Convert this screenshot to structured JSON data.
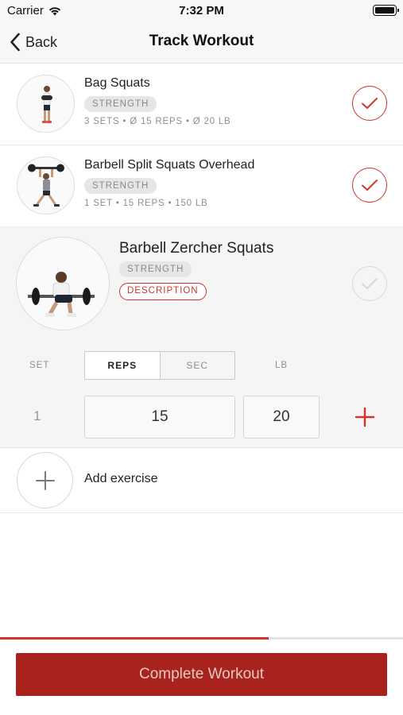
{
  "status_bar": {
    "carrier": "Carrier",
    "time": "7:32 PM"
  },
  "nav": {
    "back_label": "Back",
    "title": "Track Workout"
  },
  "exercises": [
    {
      "name": "Bag Squats",
      "tag": "STRENGTH",
      "meta": "3 SETS • Ø 15 REPS • Ø 20 LB",
      "completed": true
    },
    {
      "name": "Barbell Split Squats Overhead",
      "tag": "STRENGTH",
      "meta": "1 SET • 15 REPS • 150 LB",
      "completed": true
    }
  ],
  "active_exercise": {
    "name": "Barbell Zercher Squats",
    "tag": "STRENGTH",
    "description_label": "DESCRIPTION",
    "completed": false,
    "columns": {
      "set": "SET",
      "reps": "REPS",
      "sec": "SEC",
      "lb": "LB"
    },
    "selected_mode": "REPS",
    "sets": [
      {
        "set": "1",
        "reps": "15",
        "lb": "20"
      }
    ]
  },
  "add_exercise": {
    "label": "Add exercise"
  },
  "progress": {
    "fraction": 0.667
  },
  "complete_button": {
    "label": "Complete Workout"
  },
  "colors": {
    "accent": "#d0342c",
    "button_bg": "#a8231d",
    "button_text": "#e9c7c4",
    "bar_bg": "#f7f7f7"
  }
}
